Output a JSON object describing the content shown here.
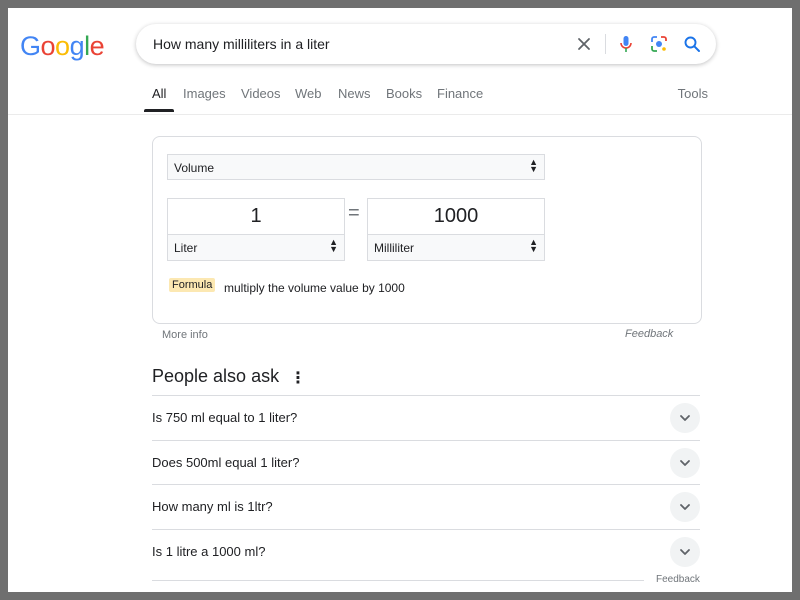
{
  "logo": {
    "letters": [
      "G",
      "o",
      "o",
      "g",
      "l",
      "e"
    ],
    "colors": [
      "#4285F4",
      "#EA4335",
      "#FBBC05",
      "#4285F4",
      "#34A853",
      "#EA4335"
    ]
  },
  "search": {
    "query": "How many milliliters in a liter"
  },
  "tabs": [
    {
      "label": "All",
      "active": true
    },
    {
      "label": "Images"
    },
    {
      "label": "Videos"
    },
    {
      "label": "Web"
    },
    {
      "label": "News"
    },
    {
      "label": "Books"
    },
    {
      "label": "Finance"
    }
  ],
  "tools_label": "Tools",
  "converter": {
    "category": "Volume",
    "from_value": "1",
    "from_unit": "Liter",
    "to_value": "1000",
    "to_unit": "Milliliter",
    "equals": "=",
    "formula_badge": "Formula",
    "formula_text": "multiply the volume value by 1000"
  },
  "more_info": "More info",
  "feedback": "Feedback",
  "paa": {
    "title": "People also ask",
    "questions": [
      "Is 750 ml equal to 1 liter?",
      "Does 500ml equal 1 liter?",
      "How many ml is 1ltr?",
      "Is 1 litre a 1000 ml?"
    ]
  },
  "feedback_bottom": "Feedback",
  "colors": {
    "accent_blue": "#1a73e8",
    "badge": "#fce8b2"
  }
}
